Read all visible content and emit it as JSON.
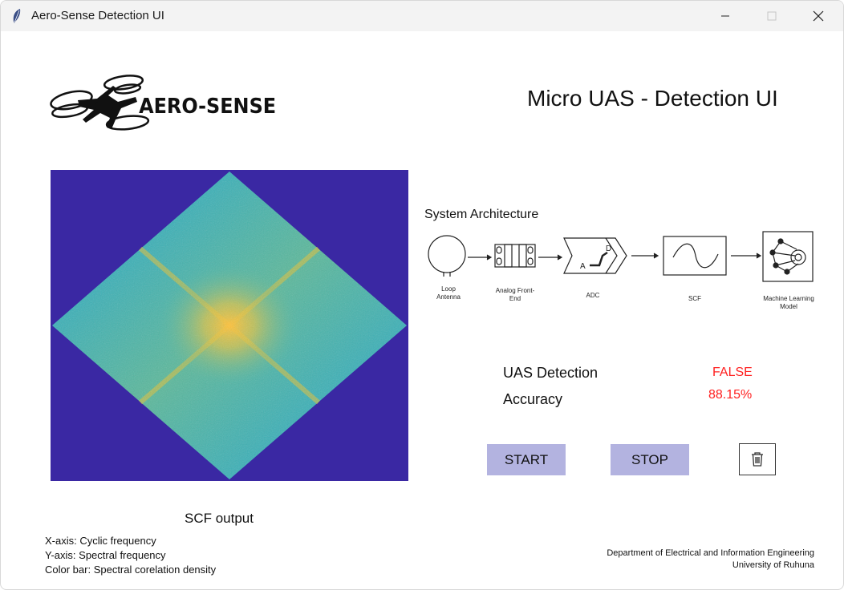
{
  "window": {
    "title": "Aero-Sense Detection UI"
  },
  "header": {
    "logo_text": "AERO-SENSE",
    "title": "Micro UAS - Detection UI"
  },
  "scf_panel": {
    "caption": "SCF output",
    "notes": [
      "X-axis: Cyclic frequency",
      "Y-axis: Spectral frequency",
      "Color bar: Spectral corelation density"
    ]
  },
  "architecture": {
    "title": "System Architecture",
    "blocks": [
      {
        "label_lines": [
          "Loop",
          "Antenna"
        ],
        "icon": "loop-antenna-icon"
      },
      {
        "label_lines": [
          "Analog Front-",
          "End"
        ],
        "icon": "analog-front-end-icon"
      },
      {
        "label_lines": [
          "ADC"
        ],
        "icon": "adc-icon"
      },
      {
        "label_lines": [
          "SCF"
        ],
        "icon": "sine-wave-icon"
      },
      {
        "label_lines": [
          "Machine Learning",
          "Model"
        ],
        "icon": "neural-network-gear-icon"
      }
    ]
  },
  "detection": {
    "uas_label": "UAS Detection",
    "uas_value": "FALSE",
    "accuracy_label": "Accuracy",
    "accuracy_value": "88.15%",
    "value_color": "#ff2020"
  },
  "controls": {
    "start_label": "START",
    "stop_label": "STOP",
    "clear_icon": "trash-icon",
    "button_color": "#b3b3e0"
  },
  "footer": {
    "line1": "Department of Electrical and Information Engineering",
    "line2": "University of Ruhuna"
  }
}
